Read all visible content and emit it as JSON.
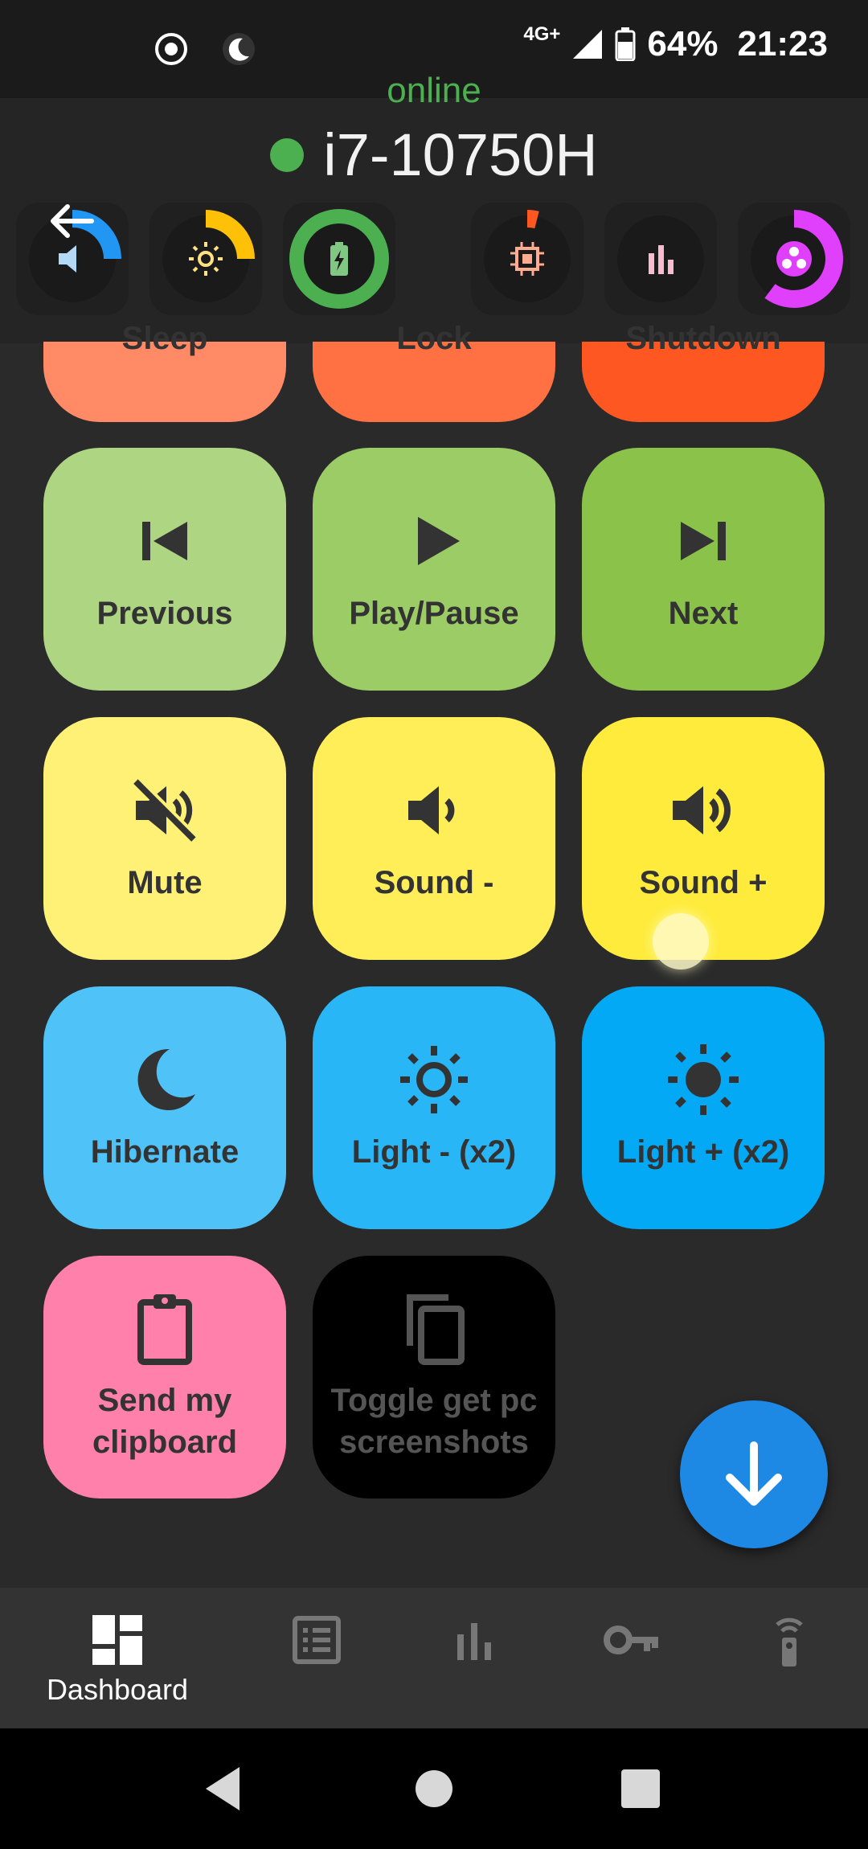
{
  "status_bar": {
    "network": "4G+",
    "battery": "64%",
    "time": "21:23",
    "icons": [
      "screen-record-icon",
      "do-not-disturb-moon-icon",
      "signal-icon",
      "battery-icon"
    ]
  },
  "header": {
    "status": "online",
    "hostname": "i7-10750H",
    "gauges": [
      {
        "name": "volume",
        "icon": "volume-icon",
        "color": "#2196f3"
      },
      {
        "name": "brightness",
        "icon": "brightness-icon",
        "color": "#ffc107"
      },
      {
        "name": "battery",
        "icon": "battery-charging-icon",
        "color": "#4caf50"
      },
      {
        "name": "cpu",
        "icon": "cpu-icon",
        "color": "#ff5722"
      },
      {
        "name": "stats",
        "icon": "bar-chart-icon",
        "color": "#f8bbd0"
      },
      {
        "name": "memory",
        "icon": "memory-icon",
        "color": "#e040fb"
      }
    ]
  },
  "tiles": {
    "sleep": "Sleep",
    "lock": "Lock",
    "shutdown": "Shutdown",
    "previous": "Previous",
    "play_pause": "Play/Pause",
    "next": "Next",
    "mute": "Mute",
    "sound_down": "Sound -",
    "sound_up": "Sound +",
    "hibernate": "Hibernate",
    "light_down": "Light - (x2)",
    "light_up": "Light + (x2)",
    "send_clipboard": "Send my clipboard",
    "toggle_screenshots": "Toggle get pc screenshots"
  },
  "colors": {
    "sleep": "#ff8a65",
    "lock": "#ff7043",
    "shutdown": "#ff5722",
    "previous": "#aed581",
    "play_pause": "#9ccc65",
    "next": "#8bc34a",
    "mute": "#fff176",
    "sound_down": "#ffee58",
    "sound_up": "#ffeb3b",
    "hibernate": "#4fc3f7",
    "light_down": "#29b6f6",
    "light_up": "#03a9f4",
    "send_clipboard": "#ff80ab",
    "toggle_screenshots": "#000000",
    "fab": "#1e88e5"
  },
  "bottom_nav": {
    "items": [
      {
        "label": "Dashboard",
        "icon": "dashboard-icon",
        "active": true
      },
      {
        "label": "",
        "icon": "list-icon",
        "active": false
      },
      {
        "label": "",
        "icon": "bar-chart-icon",
        "active": false
      },
      {
        "label": "",
        "icon": "key-icon",
        "active": false
      },
      {
        "label": "",
        "icon": "remote-icon",
        "active": false
      }
    ]
  },
  "fab": {
    "icon": "arrow-down-icon"
  }
}
